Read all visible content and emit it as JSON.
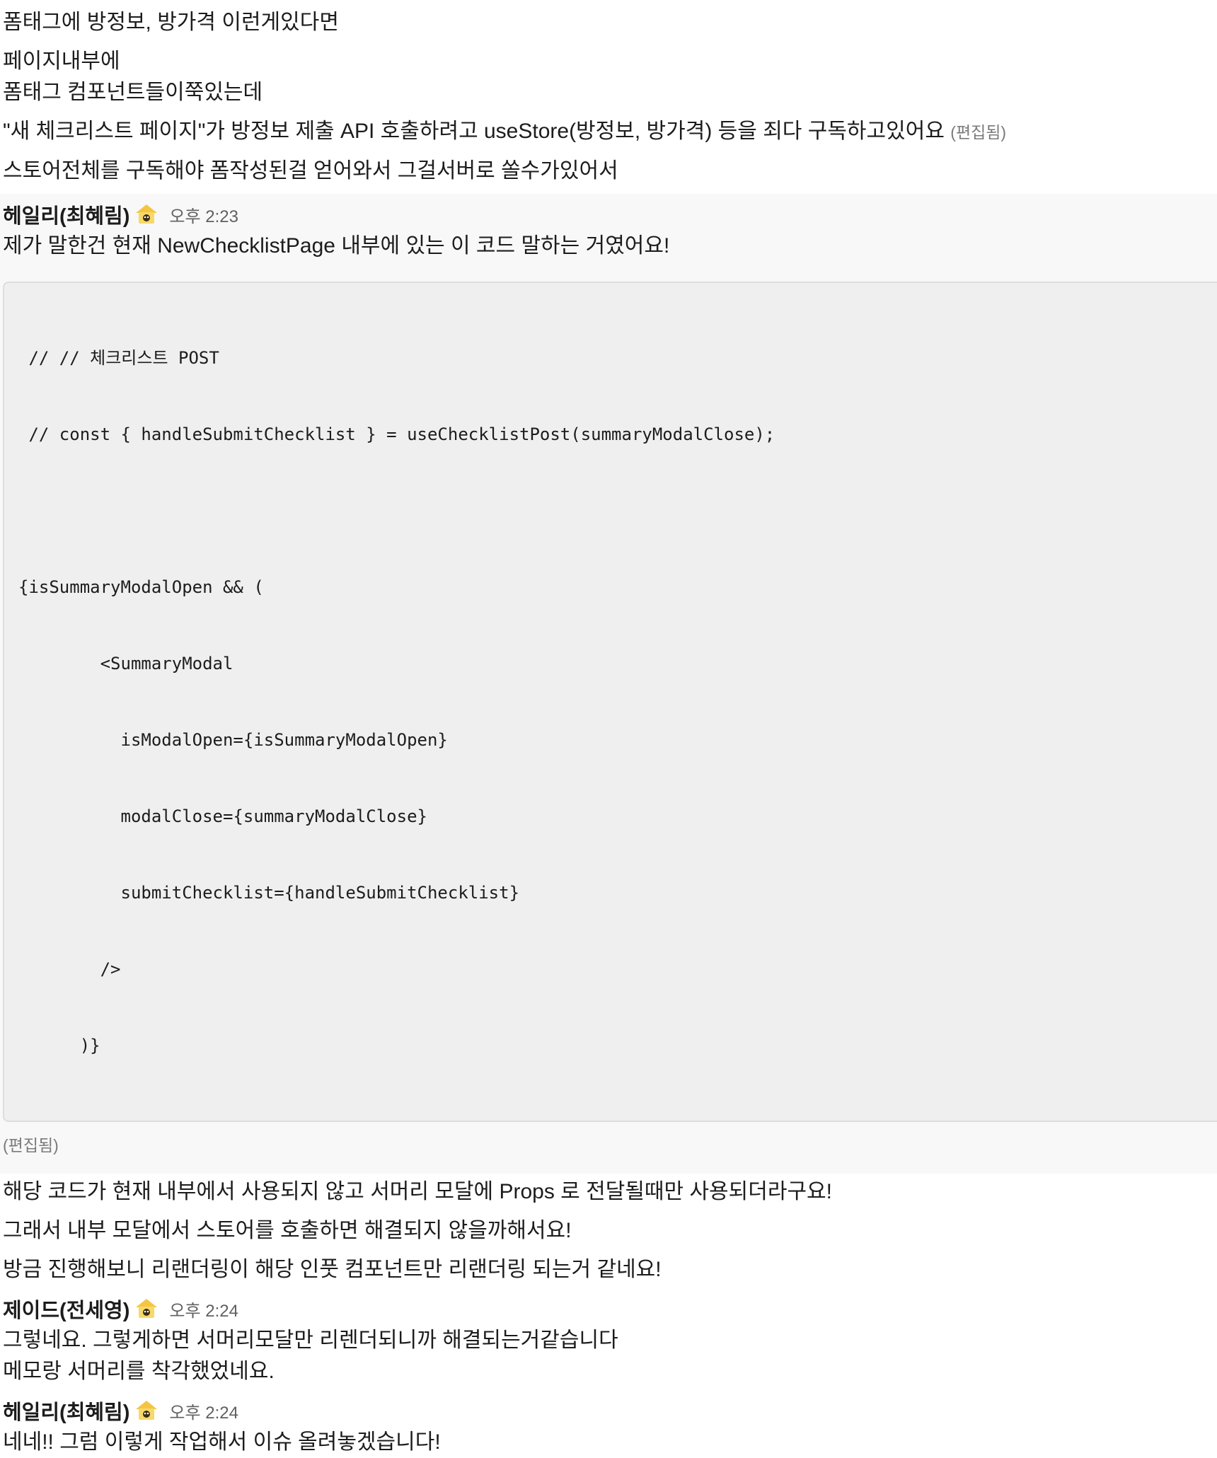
{
  "pre_messages": [
    {
      "text": "폼태그에 방정보, 방가격 이런게있다면"
    },
    {
      "text": "페이지내부에"
    },
    {
      "text": "폼태그 컴포넌트들이쭉있는데"
    },
    {
      "text": "\"새 체크리스트 페이지\"가 방정보 제출 API 호출하려고 useStore(방정보, 방가격) 등을 죄다 구독하고있어요",
      "edited": "(편집됨)"
    },
    {
      "text": "스토어전체를 구독해야 폼작성된걸 얻어와서 그걸서버로 쏠수가있어서"
    }
  ],
  "messages": [
    {
      "author": "헤일리(최혜림)",
      "time": "오후 2:23",
      "text": "제가 말한건 현재 NewChecklistPage 내부에 있는 이 코드 말하는 거였어요!",
      "code_lines": [
        " // // 체크리스트 POST",
        " // const { handleSubmitChecklist } = useChecklistPost(summaryModalClose);",
        "",
        "{isSummaryModalOpen && (",
        "        <SummaryModal",
        "          isModalOpen={isSummaryModalOpen}",
        "          modalClose={summaryModalClose}",
        "          submitChecklist={handleSubmitChecklist}",
        "        />",
        "      )}"
      ],
      "edited": "(편집됨)",
      "followups": [
        "해당 코드가 현재 내부에서 사용되지 않고 서머리 모달에 Props 로 전달될때만 사용되더라구요!",
        "그래서 내부 모달에서 스토어를 호출하면 해결되지 않을까해서요!",
        "방금 진행해보니 리랜더링이 해당 인풋 컴포넌트만 리랜더링 되는거 같네요!"
      ]
    },
    {
      "author": "제이드(전세영)",
      "time": "오후 2:24",
      "lines": [
        "그렇네요. 그렇게하면 서머리모달만 리렌더되니까 해결되는거같습니다",
        "메모랑 서머리를 착각했었네요."
      ]
    },
    {
      "author": "헤일리(최혜림)",
      "time": "오후 2:24",
      "lines": [
        "네네!! 그럼 이렇게 작업해서 이슈 올려놓겠습니다!"
      ]
    }
  ],
  "status_icon": "bee-house-icon"
}
